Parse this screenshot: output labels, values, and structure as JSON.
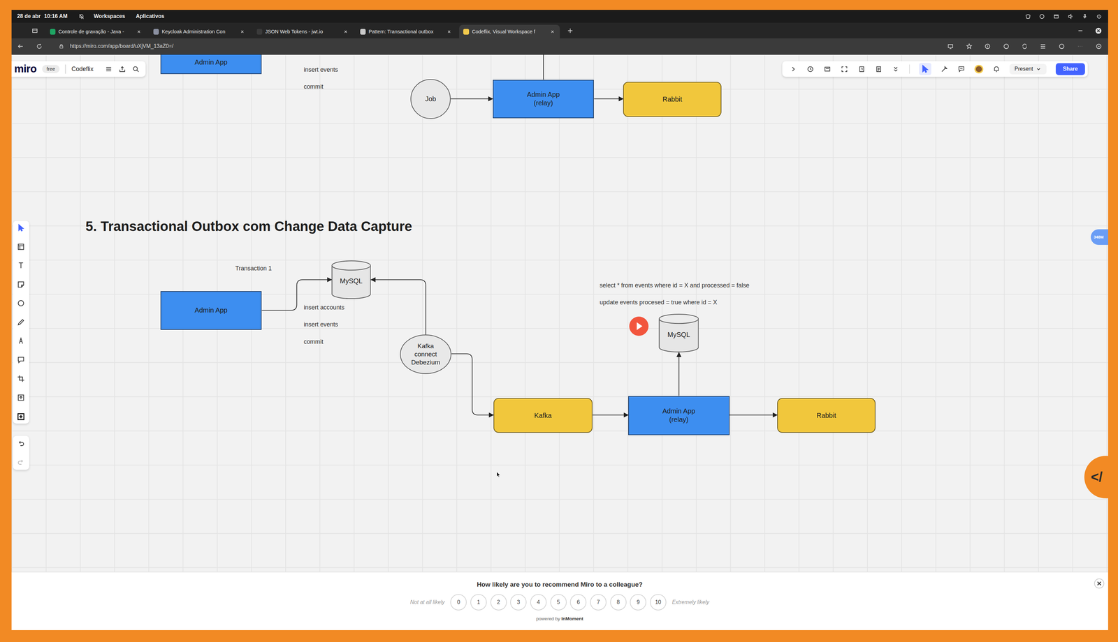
{
  "os_bar": {
    "date": "28 de abr",
    "time": "10:16 AM",
    "menus": [
      "Workspaces",
      "Aplicativos"
    ]
  },
  "browser": {
    "tabs": [
      {
        "label": "Controle de gravação - Java -",
        "selected": false
      },
      {
        "label": "Keycloak Administration Con",
        "selected": false
      },
      {
        "label": "JSON Web Tokens - jwt.io",
        "selected": false
      },
      {
        "label": "Pattern: Transactional outbox",
        "selected": false
      },
      {
        "label": "Codeflix, Visual Workspace f",
        "selected": true
      }
    ],
    "url": "https://miro.com/app/board/uXjVM_13aZ0=/"
  },
  "miro": {
    "logo": "miro",
    "plan": "free",
    "board": "Codeflix",
    "present": "Present",
    "share": "Share",
    "collaborators": "348M",
    "embed_button": "</"
  },
  "diagram": {
    "title": "5. Transactional Outbox com Change Data Capture",
    "nodes": [
      {
        "label": "Admin App",
        "kind": "app"
      },
      {
        "label": "Job",
        "kind": "job"
      },
      {
        "label": "Admin App\n(relay)",
        "kind": "app"
      },
      {
        "label": "Rabbit",
        "kind": "broker"
      },
      {
        "label": "Admin App",
        "kind": "app"
      },
      {
        "label": "MySQL",
        "kind": "database"
      },
      {
        "label": "Kafka\nconnect\nDebezium",
        "kind": "connector"
      },
      {
        "label": "Kafka",
        "kind": "broker"
      },
      {
        "label": "Admin App\n(relay)",
        "kind": "app"
      },
      {
        "label": "MySQL",
        "kind": "database"
      },
      {
        "label": "Rabbit",
        "kind": "broker"
      }
    ],
    "notes": [
      "insert events",
      "commit",
      "Transaction 1",
      "insert accounts",
      "insert events",
      "commit",
      "select * from events where id = X and processed = false",
      "update events procesed = true where id = X"
    ]
  },
  "survey": {
    "question": "How likely are you to recommend Miro to a colleague?",
    "low_label": "Not at all likely",
    "high_label": "Extremely likely",
    "scores": [
      "0",
      "1",
      "2",
      "3",
      "4",
      "5",
      "6",
      "7",
      "8",
      "9",
      "10"
    ],
    "powered_by": "powered by",
    "brand": "InMoment"
  }
}
